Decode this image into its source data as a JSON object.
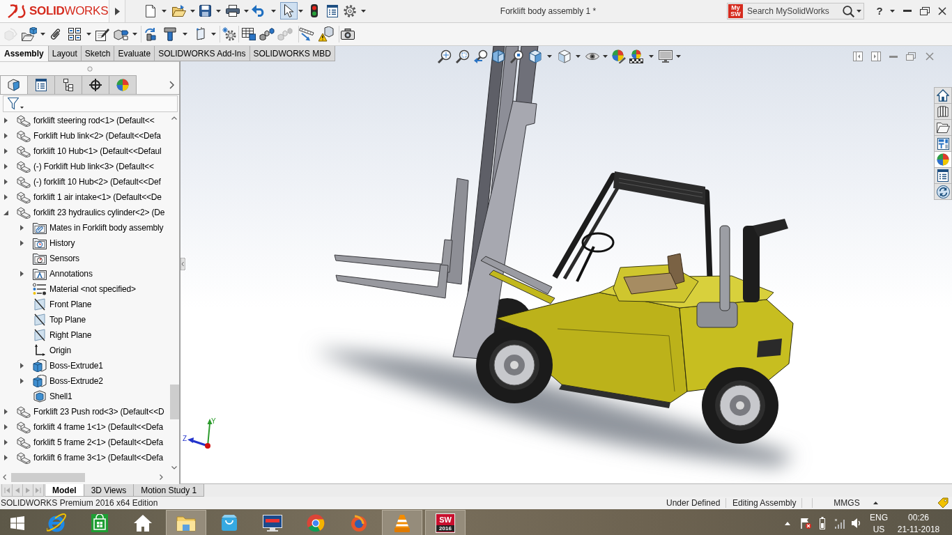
{
  "title_bar": {
    "brand": "**SOLID**WORKS",
    "title": "Forklift body assembly 1 *",
    "search": {
      "logo": [
        "My",
        "SW"
      ],
      "placeholder": "Search MySolidWorks"
    },
    "help": "?"
  },
  "quick_access": [
    {
      "pressed": false
    },
    {
      "pressed": false
    },
    {
      "pressed": false
    },
    {
      "pressed": false
    },
    {
      "pressed": false
    },
    {
      "pressed": true
    },
    {
      "pressed": false
    },
    {
      "pressed": false
    },
    {
      "pressed": false
    }
  ],
  "command_buttons": [
    {
      "disabled": true
    },
    {
      "disabled": false
    },
    {
      "disabled": false
    },
    {
      "disabled": false
    },
    {
      "disabled": false
    },
    {
      "disabled": false
    },
    {
      "disabled": false
    },
    {
      "disabled": false
    },
    {
      "disabled": false
    },
    {
      "disabled": false
    },
    {
      "disabled": false
    },
    {
      "disabled": false
    },
    {
      "disabled": true
    },
    {
      "disabled": false
    },
    {
      "disabled": false
    },
    {
      "disabled": false
    }
  ],
  "command_tabs": [
    {
      "label": "Assembly",
      "selected": true
    },
    {
      "label": "Layout",
      "selected": false
    },
    {
      "label": "Sketch",
      "selected": false
    },
    {
      "label": "Evaluate",
      "selected": false
    },
    {
      "label": "SOLIDWORKS Add-Ins",
      "selected": false
    },
    {
      "label": "SOLIDWORKS MBD",
      "selected": false
    }
  ],
  "feature_manager": {
    "tabs": [
      {
        "selected": true
      },
      {
        "selected": false
      },
      {
        "selected": false
      },
      {
        "selected": false
      },
      {
        "selected": false
      }
    ],
    "tree": [
      {
        "label": "forklift steering rod<1> (Default<<",
        "kind": "part",
        "expanded": false
      },
      {
        "label": "Forklift Hub link<2> (Default<<Defa",
        "kind": "part",
        "expanded": false
      },
      {
        "label": "forklift 10 Hub<1> (Default<<Defaul",
        "kind": "part",
        "expanded": false
      },
      {
        "label": "(-) Forklift Hub link<3> (Default<<",
        "kind": "part",
        "expanded": false
      },
      {
        "label": "(-) forklift 10 Hub<2> (Default<<Def",
        "kind": "part",
        "expanded": false
      },
      {
        "label": "forklift 1 air intake<1> (Default<<De",
        "kind": "part",
        "expanded": false
      },
      {
        "label": "forklift 23 hydraulics cylinder<2> (De",
        "kind": "part",
        "expanded": true,
        "children": [
          {
            "label": "Mates in Forklift body assembly",
            "kind": "mates",
            "expanded": false
          },
          {
            "label": "History",
            "kind": "history",
            "expanded": false
          },
          {
            "label": "Sensors",
            "kind": "sensors"
          },
          {
            "label": "Annotations",
            "kind": "annotations",
            "expanded": false
          },
          {
            "label": "Material <not specified>",
            "kind": "material"
          },
          {
            "label": "Front Plane",
            "kind": "plane"
          },
          {
            "label": "Top Plane",
            "kind": "plane"
          },
          {
            "label": "Right Plane",
            "kind": "plane"
          },
          {
            "label": "Origin",
            "kind": "origin"
          },
          {
            "label": "Boss-Extrude1",
            "kind": "extrude",
            "expanded": false
          },
          {
            "label": "Boss-Extrude2",
            "kind": "extrude",
            "expanded": false
          },
          {
            "label": "Shell1",
            "kind": "shell"
          }
        ]
      },
      {
        "label": "Forklift 23 Push rod<3> (Default<<D",
        "kind": "part",
        "expanded": false
      },
      {
        "label": "forklift 4 frame 1<1> (Default<<Defa",
        "kind": "part",
        "expanded": false
      },
      {
        "label": "forklift 5 frame 2<1> (Default<<Defa",
        "kind": "part",
        "expanded": false
      },
      {
        "label": "forklift 6 frame 3<1> (Default<<Defa",
        "kind": "part",
        "expanded": false
      }
    ]
  },
  "bottom_tabs": {
    "nav_disabled": true,
    "tabs": [
      {
        "label": "Model",
        "selected": true
      },
      {
        "label": "3D Views",
        "selected": false
      },
      {
        "label": "Motion Study 1",
        "selected": false
      }
    ]
  },
  "viewport": {
    "triad": {
      "y": "Y",
      "z": "Z"
    },
    "task_pane": [
      {
        "selected": false
      },
      {
        "selected": false
      },
      {
        "selected": false
      },
      {
        "selected": false
      },
      {
        "selected": true
      },
      {
        "selected": false
      },
      {
        "selected": false
      }
    ]
  },
  "status_bar": {
    "edition": "SOLIDWORKS Premium 2016 x64 Edition",
    "fields": [
      "Under Defined",
      "Editing Assembly",
      "MMGS"
    ]
  },
  "taskbar": {
    "apps": [
      {
        "running": false
      },
      {
        "running": false
      },
      {
        "running": false
      },
      {
        "running": true
      },
      {
        "running": false
      },
      {
        "running": false
      },
      {
        "running": false
      },
      {
        "running": false
      },
      {
        "running": true
      },
      {
        "running": true
      }
    ],
    "solidworks_logo": [
      "SW",
      "2016"
    ],
    "language": [
      "ENG",
      "US"
    ],
    "time": "00:26",
    "date": "21-11-2018"
  }
}
